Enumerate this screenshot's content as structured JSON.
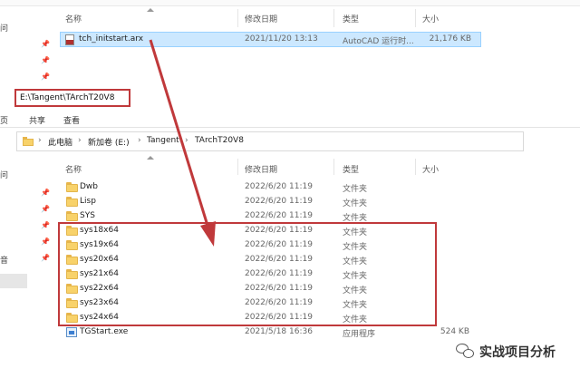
{
  "top_window": {
    "nav_fragment": "问",
    "headers": {
      "name": "名称",
      "date": "修改日期",
      "type": "类型",
      "size": "大小"
    },
    "file": {
      "name": "tch_initstart.arx",
      "date": "2021/11/20 13:13",
      "type": "AutoCAD 运行时...",
      "size": "21,176 KB"
    }
  },
  "address_box": {
    "text": "E:\\Tangent\\TArchT20V8"
  },
  "ribbon": {
    "left": "页",
    "share": "共享",
    "view": "查看"
  },
  "breadcrumb": {
    "pc": "此电脑",
    "drive": "新加卷 (E:)",
    "folder1": "Tangent",
    "folder2": "TArchT20V8"
  },
  "bottom_window": {
    "headers": {
      "name": "名称",
      "date": "修改日期",
      "type": "类型",
      "size": "大小"
    },
    "left_fragments": {
      "a": "问",
      "b": "音"
    },
    "rows": [
      {
        "name": "Dwb",
        "date": "2022/6/20 11:19",
        "type": "文件夹",
        "size": ""
      },
      {
        "name": "Lisp",
        "date": "2022/6/20 11:19",
        "type": "文件夹",
        "size": ""
      },
      {
        "name": "SYS",
        "date": "2022/6/20 11:19",
        "type": "文件夹",
        "size": ""
      },
      {
        "name": "sys18x64",
        "date": "2022/6/20 11:19",
        "type": "文件夹",
        "size": ""
      },
      {
        "name": "sys19x64",
        "date": "2022/6/20 11:19",
        "type": "文件夹",
        "size": ""
      },
      {
        "name": "sys20x64",
        "date": "2022/6/20 11:19",
        "type": "文件夹",
        "size": ""
      },
      {
        "name": "sys21x64",
        "date": "2022/6/20 11:19",
        "type": "文件夹",
        "size": ""
      },
      {
        "name": "sys22x64",
        "date": "2022/6/20 11:19",
        "type": "文件夹",
        "size": ""
      },
      {
        "name": "sys23x64",
        "date": "2022/6/20 11:19",
        "type": "文件夹",
        "size": ""
      },
      {
        "name": "sys24x64",
        "date": "2022/6/20 11:19",
        "type": "文件夹",
        "size": ""
      },
      {
        "name": "TGStart.exe",
        "date": "2021/5/18 16:36",
        "type": "应用程序",
        "size": "524 KB"
      }
    ]
  },
  "watermark": {
    "text": "实战项目分析"
  },
  "colors": {
    "accent_red": "#c0393b",
    "selection": "#cce8ff",
    "folder": "#f8d26a"
  }
}
